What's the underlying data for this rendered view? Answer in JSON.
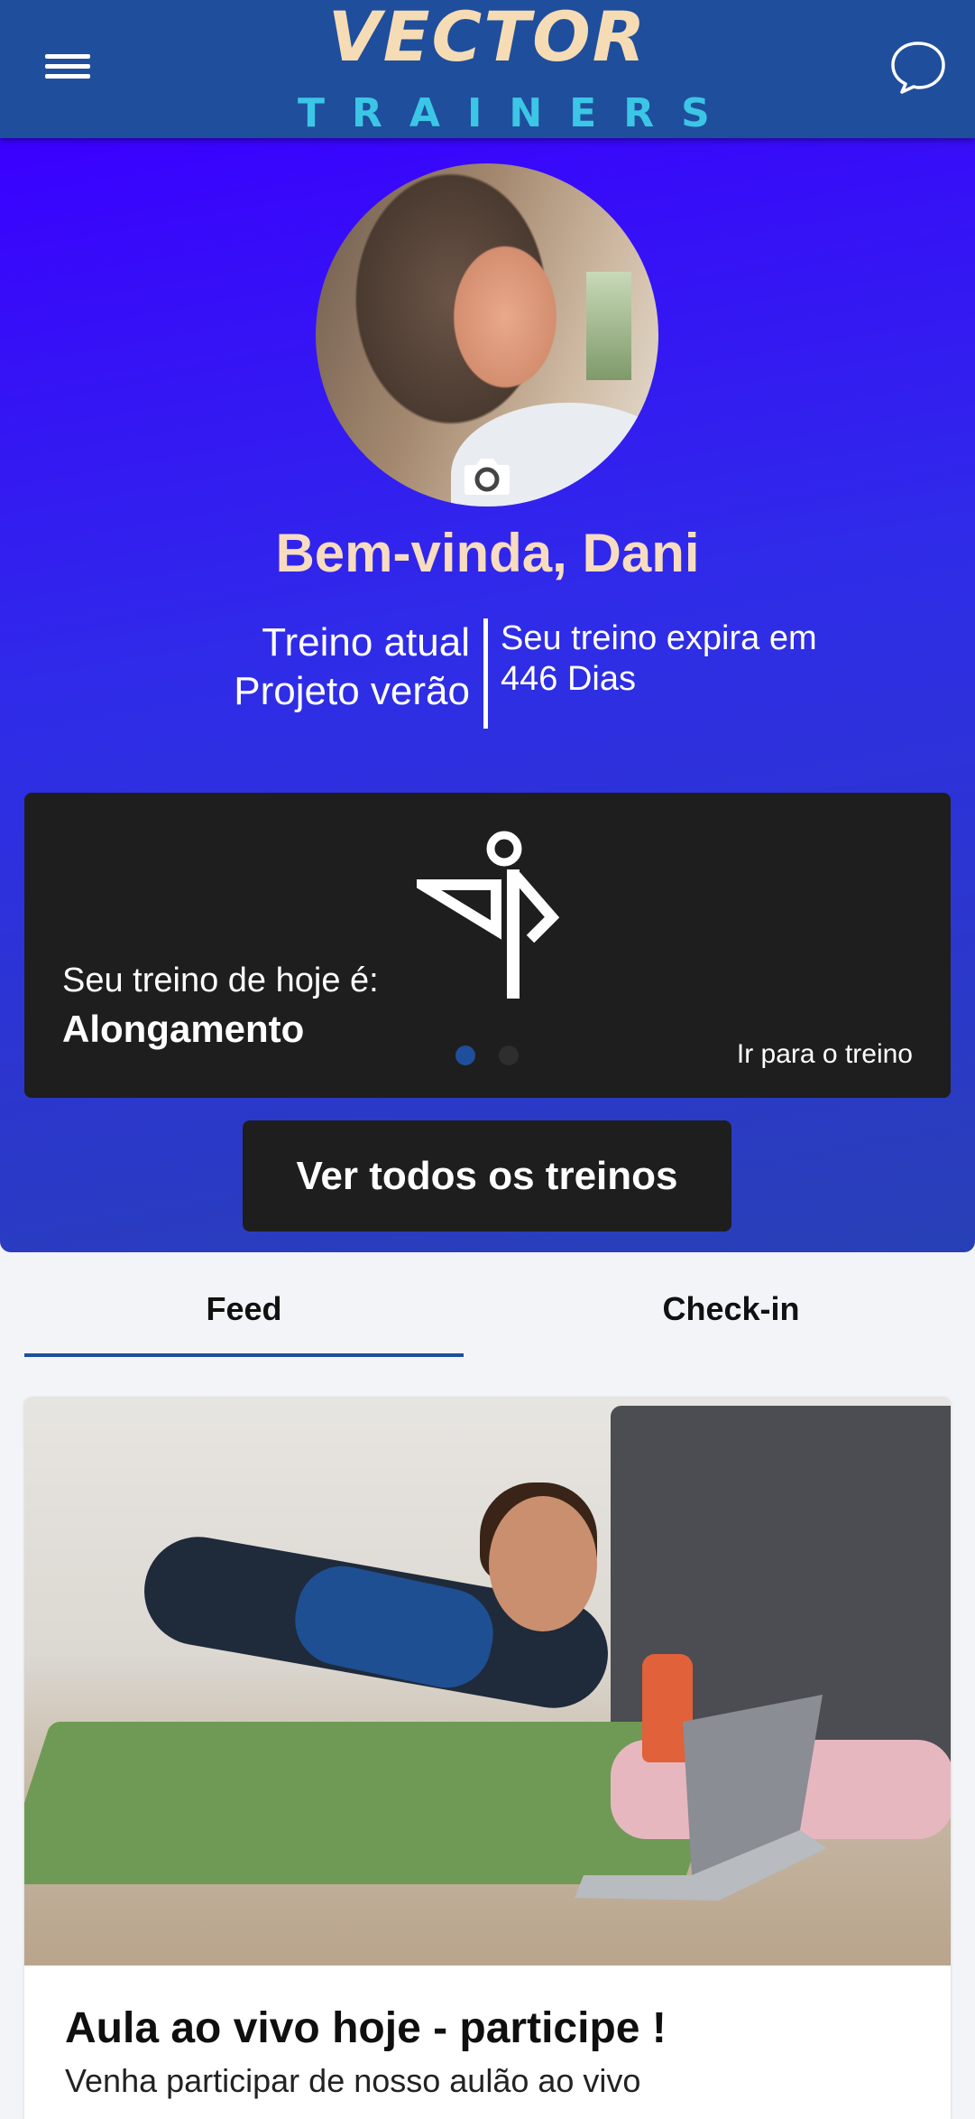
{
  "header": {
    "logo_top": "VECTOR",
    "logo_bottom": "TRAINERS",
    "brand_colors": {
      "bar": "#1f4e9c",
      "logo_top": "#f6dcb4",
      "logo_bottom": "#3cc6e6"
    },
    "icons": {
      "menu": "hamburger-menu-icon",
      "chat": "chat-bubble-icon"
    }
  },
  "profile": {
    "welcome": "Bem-vinda, Dani",
    "current_label": "Treino atual",
    "current_value": "Projeto verão",
    "expires_label": "Seu treino expira em",
    "expires_value": "446 Dias",
    "camera_icon": "camera-icon"
  },
  "workout_card": {
    "label": "Seu treino de hoje é:",
    "value": "Alongamento",
    "icon": "stretch-pose-icon",
    "link": "Ir para o treino",
    "carousel": {
      "total": 2,
      "active_index": 0
    }
  },
  "view_all_button": "Ver todos os treinos",
  "tabs": [
    {
      "label": "Feed",
      "active": true
    },
    {
      "label": "Check-in",
      "active": false
    }
  ],
  "feed": {
    "title": "Aula ao vivo hoje - participe !",
    "subtitle": "Venha participar de nosso aulão ao vivo"
  }
}
